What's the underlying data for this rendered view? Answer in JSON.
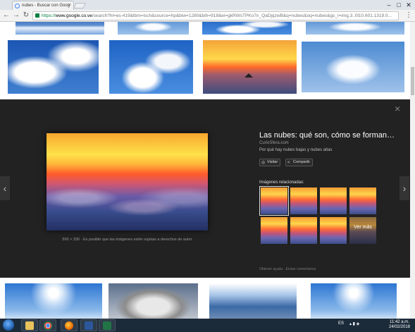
{
  "browser": {
    "tab_title": "nubes - Buscar con Goog",
    "tab_close": "×",
    "window_controls": {
      "minimize": "–",
      "maximize": "□",
      "close": "✕"
    },
    "url": {
      "scheme": "https://",
      "domain": "www.google.co.ve",
      "path": "/search?hl=es-419&tbm=isch&source=hp&biw=1280&bih=918&ei=gkRWsTPKo7n_QaDjqzwB&q=nubes&oq=nubes&gs_l=img.3..0l10.601.1319.0..."
    },
    "nav_icons": [
      "back-arrow-icon",
      "forward-arrow-icon",
      "reload-icon"
    ]
  },
  "detail_panel": {
    "title": "Las nubes: qué son, cómo se forman…",
    "site": "CurioSfera.com",
    "description": "Por qué hay nubes bajas y nubes altas",
    "visit_label": "Visitar",
    "share_label": "Compartir",
    "caption_size": "500 × 330",
    "caption_text": "Es posible que las imágenes estén sujetas a derechos de autor.",
    "related_title": "Imágenes relacionadas:",
    "see_more_label": "Ver más",
    "footer_help": "Obtener ayuda",
    "footer_feedback": "Enviar comentarios",
    "prev_arrow": "‹",
    "next_arrow": "›",
    "close_glyph": "×"
  },
  "taskbar": {
    "language": "ES",
    "time": "11:42 a.m.",
    "date": "24/02/2018",
    "apps": [
      "file-explorer-icon",
      "chrome-icon",
      "firefox-icon",
      "word-icon",
      "excel-icon"
    ]
  }
}
